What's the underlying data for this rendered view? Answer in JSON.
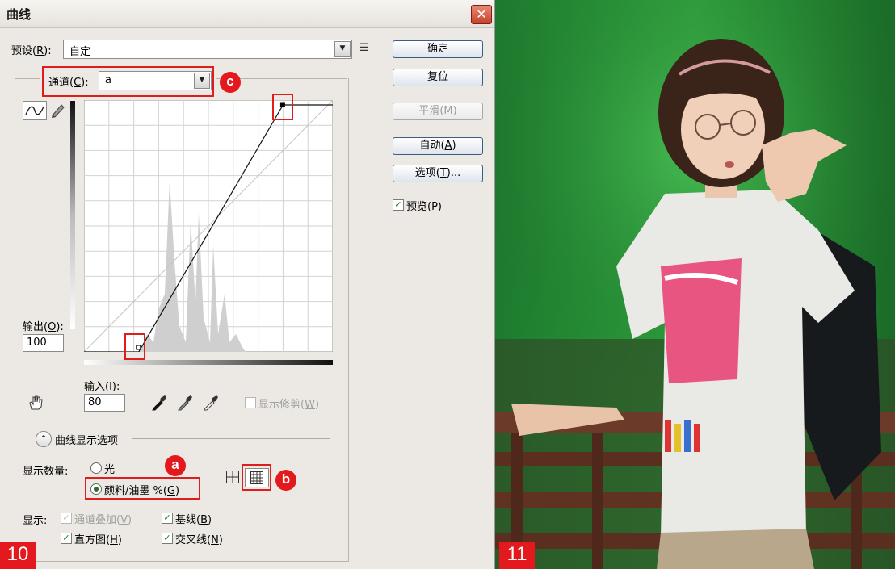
{
  "dialog": {
    "title": "曲线",
    "close_glyph": "✕",
    "preset": {
      "label_prefix": "预设(",
      "hotkey": "R",
      "label_suffix": "):",
      "value": "自定"
    },
    "channel": {
      "label_prefix": "通道(",
      "hotkey": "C",
      "label_suffix": "):",
      "value": "a"
    },
    "buttons": {
      "ok": "确定",
      "reset": "复位",
      "smooth_prefix": "平滑(",
      "smooth_hotkey": "M",
      "smooth_suffix": ")",
      "auto_prefix": "自动(",
      "auto_hotkey": "A",
      "auto_suffix": ")",
      "options_prefix": "选项(",
      "options_hotkey": "T",
      "options_suffix": ")..."
    },
    "preview": {
      "label_prefix": "预览(",
      "hotkey": "P",
      "label_suffix": ")",
      "checked": true
    },
    "output": {
      "label_prefix": "输出(",
      "hotkey": "O",
      "label_suffix": "):",
      "value": "100"
    },
    "input": {
      "label_prefix": "输入(",
      "hotkey": "I",
      "label_suffix": "):",
      "value": "80"
    },
    "show_clipping": {
      "label_prefix": "显示修剪(",
      "hotkey": "W",
      "label_suffix": ")",
      "checked": false,
      "enabled": false
    },
    "display_options": {
      "title": "曲线显示选项",
      "toggle_glyph": "⌃"
    },
    "show_amount": {
      "label": "显示数量:",
      "light": "光",
      "pigment_prefix": "颜料/油墨 %(",
      "pigment_hotkey": "G",
      "pigment_suffix": ")",
      "selected": "pigment"
    },
    "show": {
      "label": "显示:",
      "channel_overlay_prefix": "通道叠加(",
      "channel_overlay_hotkey": "V",
      "channel_overlay_suffix": ")",
      "baseline_prefix": "基线(",
      "baseline_hotkey": "B",
      "baseline_suffix": ")",
      "histogram_prefix": "直方图(",
      "histogram_hotkey": "H",
      "histogram_suffix": ")",
      "intersection_prefix": "交叉线(",
      "intersection_hotkey": "N",
      "intersection_suffix": ")",
      "channel_overlay_checked": true,
      "baseline_checked": true,
      "histogram_checked": true,
      "intersection_checked": true
    },
    "curve": {
      "black_point": [
        0.22,
        0
      ],
      "white_point": [
        0.8,
        1
      ]
    },
    "badges": {
      "a": "a",
      "b": "b",
      "c": "c"
    },
    "check_glyph": "✓",
    "arrow_glyph": "▼",
    "menu_glyph": "☰"
  },
  "figure_numbers": {
    "left": "10",
    "right": "11"
  },
  "colors": {
    "accent_red": "#e3191d",
    "dialog_bg": "#ece9e4",
    "button_border": "#3c5a8a"
  }
}
